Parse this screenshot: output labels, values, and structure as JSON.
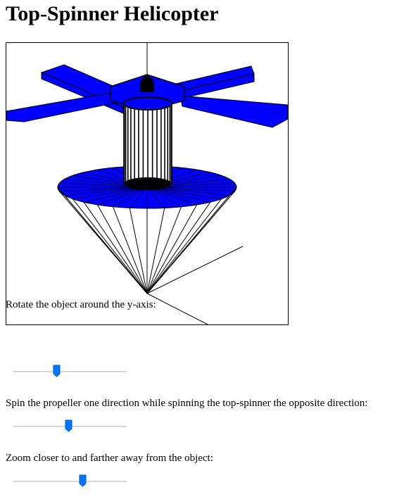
{
  "page": {
    "title": "Top-Spinner Helicopter"
  },
  "colors": {
    "body": "#0000ff",
    "edges": "#000000",
    "slider_accent": "#0075ff",
    "slider_track": "#d6d6d6"
  },
  "controls": [
    {
      "label": "Rotate the object around the y-axis:",
      "value": 0.38
    },
    {
      "label": "Spin the propeller one direction while spinning the top-spinner the opposite direction:",
      "value": 0.49
    },
    {
      "label": "Zoom closer to and farther away from the object:",
      "value": 0.61
    }
  ]
}
